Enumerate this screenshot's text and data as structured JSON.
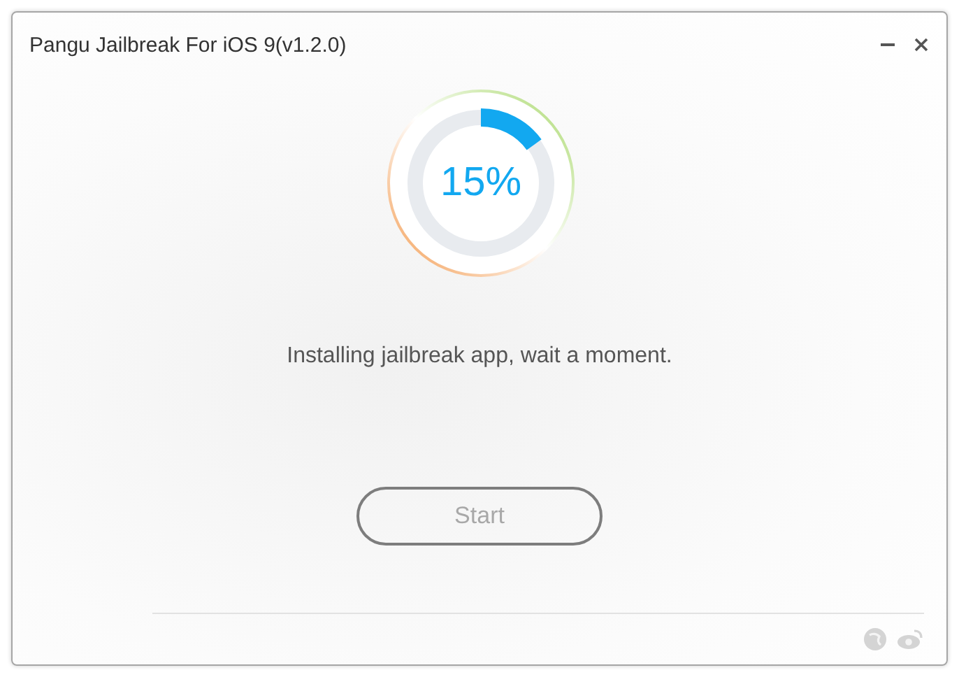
{
  "window": {
    "title": "Pangu Jailbreak For iOS 9(v1.2.0)"
  },
  "progress": {
    "level": 0.15,
    "reading": "15%"
  },
  "message": "Installing jailbreak app, wait a moment.",
  "start_button": {
    "label": "Start",
    "disabled": true
  }
}
